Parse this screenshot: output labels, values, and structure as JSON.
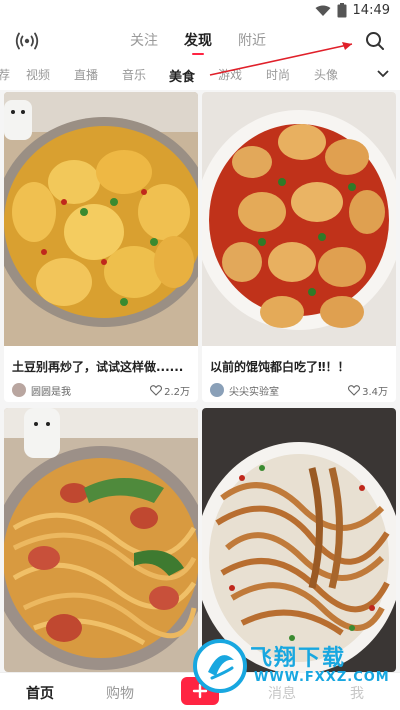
{
  "status_bar": {
    "time": "14:49"
  },
  "top_nav": {
    "tabs": [
      {
        "label": "关注",
        "active": false
      },
      {
        "label": "发现",
        "active": true
      },
      {
        "label": "附近",
        "active": false
      }
    ]
  },
  "categories": {
    "items": [
      "荐",
      "视频",
      "直播",
      "音乐",
      "美食",
      "游戏",
      "时尚",
      "头像"
    ],
    "active": "美食"
  },
  "feed": {
    "cards": [
      {
        "title": "土豆别再炒了，试试这样做......",
        "author": "圆圆是我",
        "likes": "2.2万"
      },
      {
        "title": "以前的馄饨都白吃了‼！！",
        "author": "尖尖实验室",
        "likes": "3.4万"
      },
      {
        "title": "",
        "author": "",
        "likes": ""
      },
      {
        "title": "",
        "author": "",
        "likes": ""
      }
    ]
  },
  "bottom_nav": {
    "home": "首页",
    "shop": "购物",
    "messages": "消息",
    "me": "我"
  },
  "watermark": {
    "text": "飞翔下载",
    "url": "WWW.FXXZ.COM"
  },
  "colors": {
    "accent": "#ff2442",
    "watermark": "#18a7e0"
  }
}
